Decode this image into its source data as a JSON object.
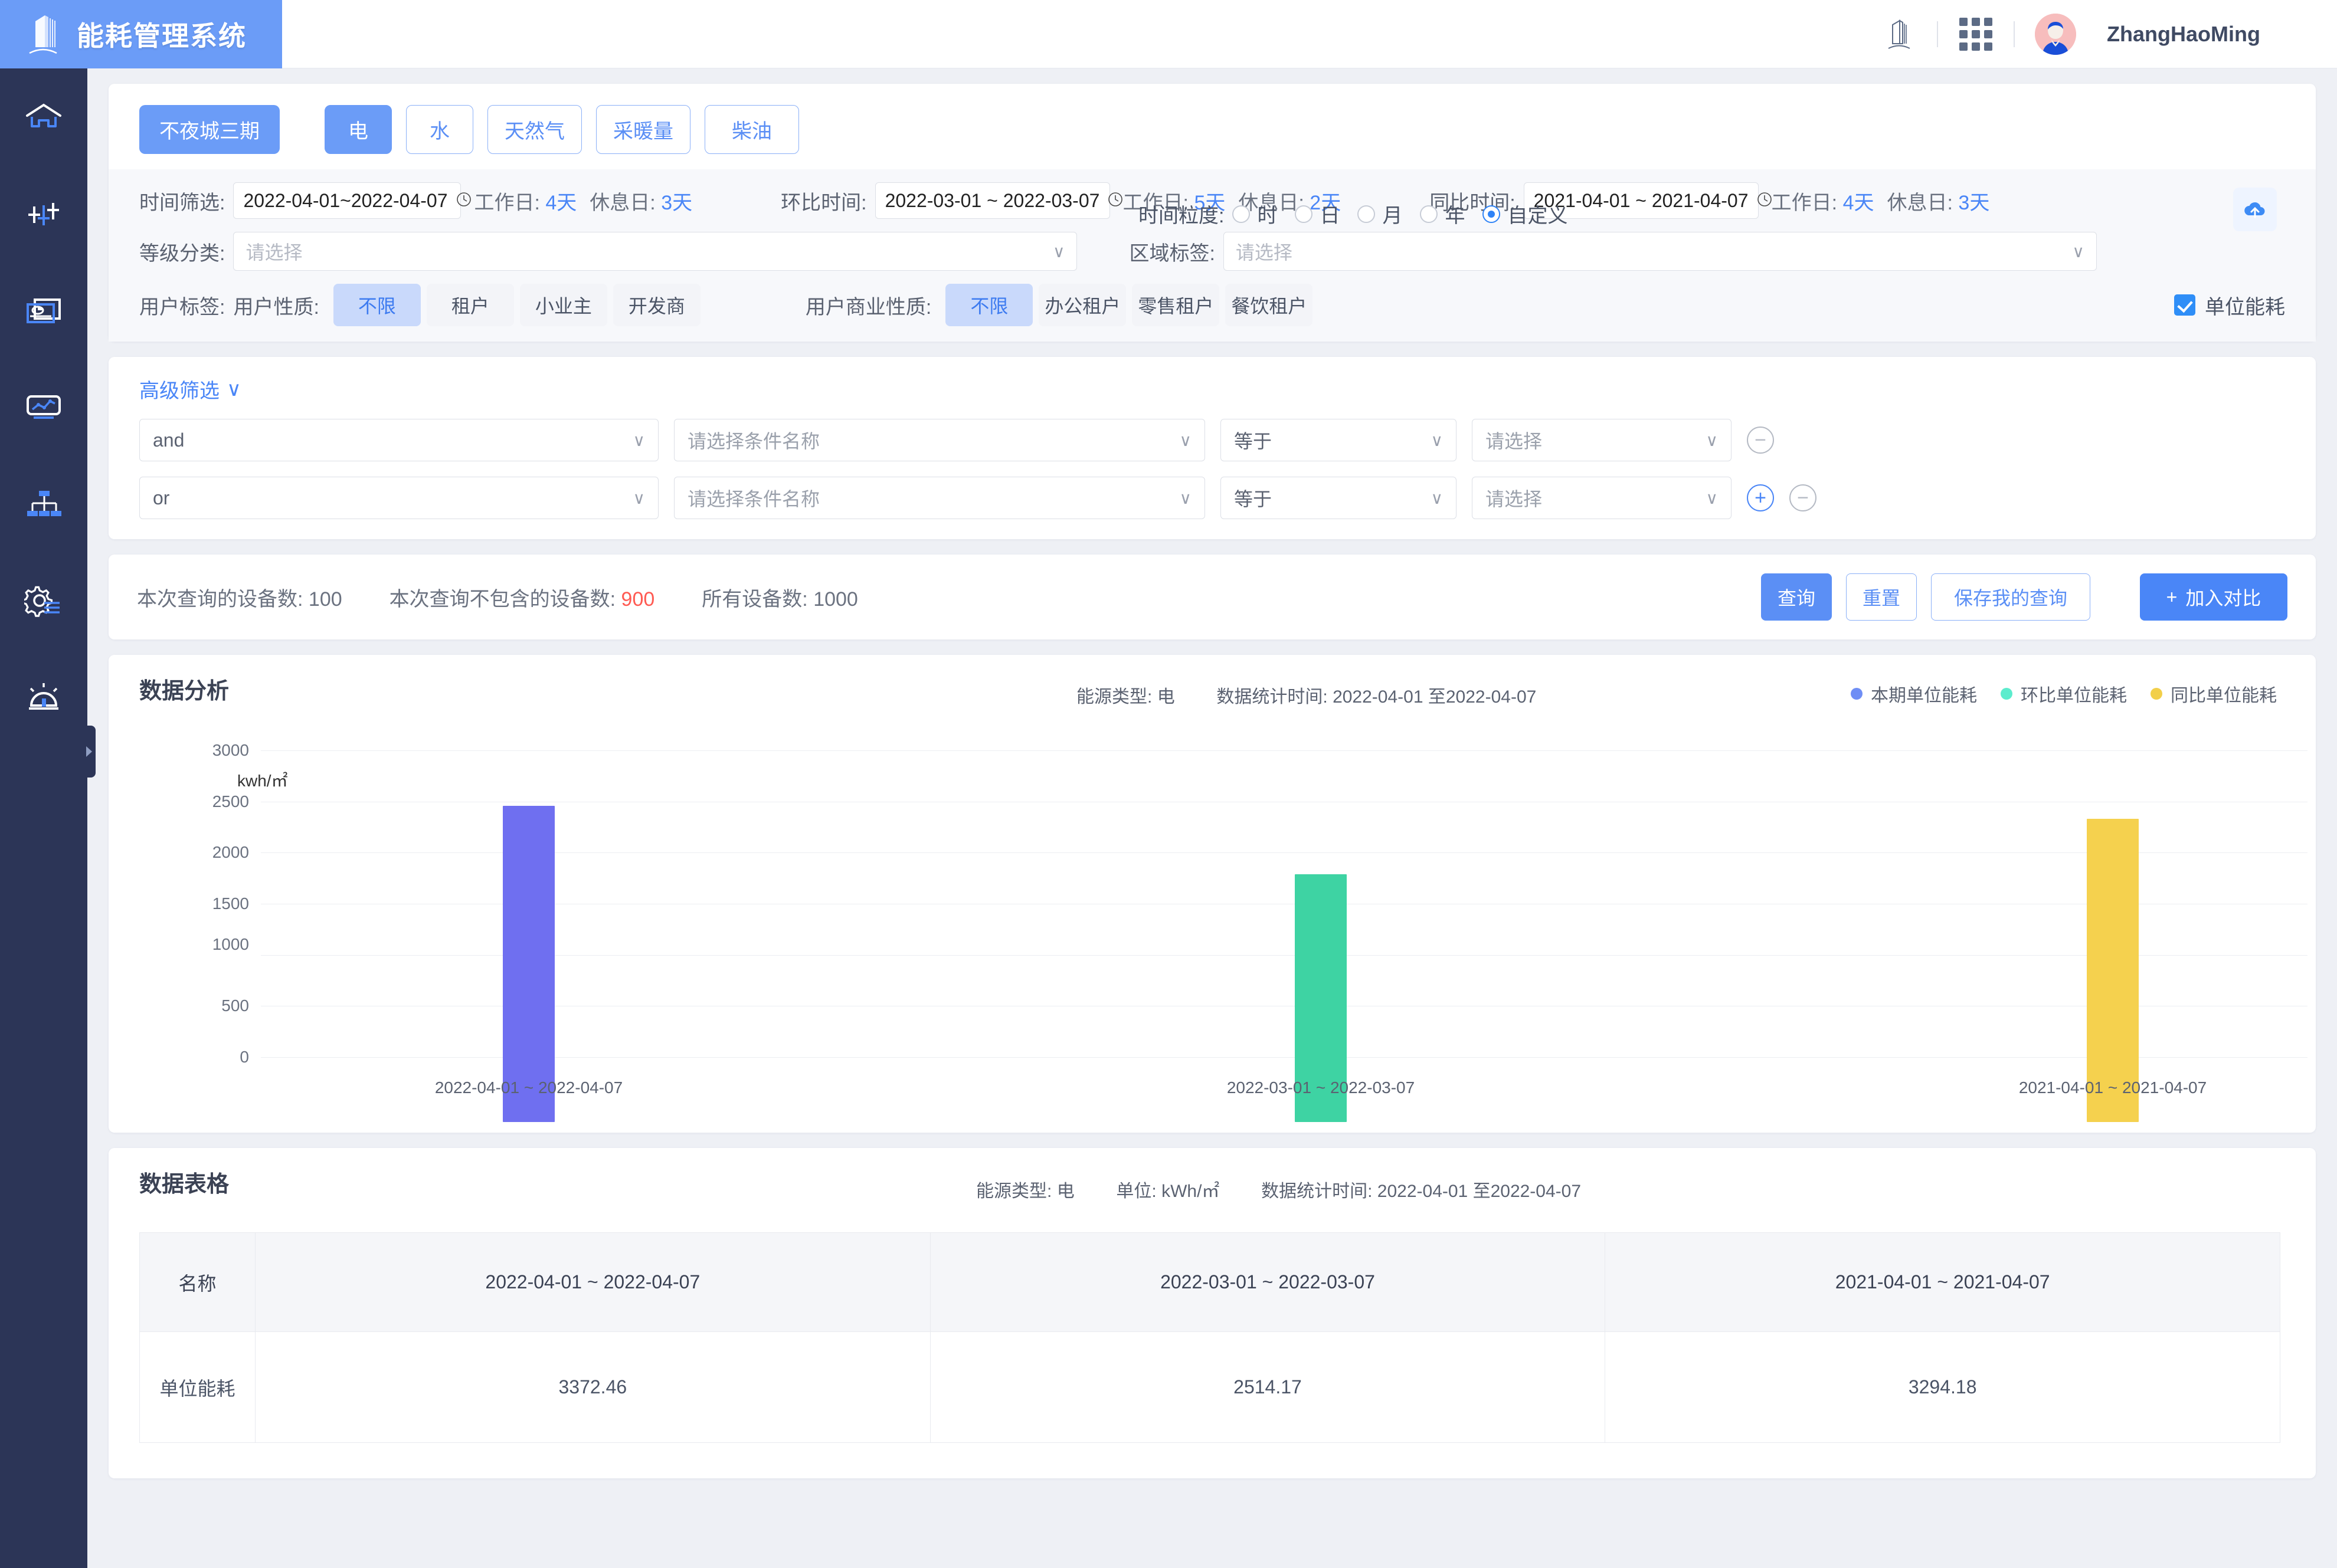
{
  "header": {
    "brand_title": "能耗管理系统",
    "building_icon": "building-icon",
    "apps_icon": "apps-grid-icon",
    "username": "ZhangHaoMing"
  },
  "sidebar": {
    "items": [
      {
        "name": "home",
        "icon": "home-icon"
      },
      {
        "name": "monitor",
        "icon": "sliders-icon"
      },
      {
        "name": "report",
        "icon": "report-card-icon"
      },
      {
        "name": "analysis",
        "icon": "line-chart-icon"
      },
      {
        "name": "topology",
        "icon": "org-tree-icon"
      },
      {
        "name": "settings",
        "icon": "gear-settings-icon"
      },
      {
        "name": "alarm",
        "icon": "alarm-dome-icon"
      }
    ],
    "collapse_handle": "sidebar-collapse-handle"
  },
  "filters": {
    "project_button": "不夜城三期",
    "energy_tabs": [
      {
        "label": "电",
        "active": true
      },
      {
        "label": "水",
        "active": false
      },
      {
        "label": "天然气",
        "active": false
      },
      {
        "label": "采暖量",
        "active": false
      },
      {
        "label": "柴油",
        "active": false
      }
    ],
    "granularity": {
      "label": "时间粒度:",
      "options": [
        {
          "label": "时",
          "selected": false
        },
        {
          "label": "日",
          "selected": false
        },
        {
          "label": "月",
          "selected": false
        },
        {
          "label": "年",
          "selected": false
        },
        {
          "label": "自定义",
          "selected": true
        }
      ]
    },
    "upload_icon": "cloud-upload-icon",
    "time_filter": {
      "label": "时间筛选:",
      "value": "2022-04-01~2022-04-07",
      "workday_label": "工作日:",
      "workday_value": "4天",
      "restday_label": "休息日:",
      "restday_value": "3天"
    },
    "mom_time": {
      "label": "环比时间:",
      "value": "2022-03-01 ~ 2022-03-07",
      "workday_label": "工作日:",
      "workday_value": "5天",
      "restday_label": "休息日:",
      "restday_value": "2天"
    },
    "yoy_time": {
      "label": "同比时间:",
      "value": "2021-04-01 ~ 2021-04-07",
      "workday_label": "工作日:",
      "workday_value": "4天",
      "restday_label": "休息日:",
      "restday_value": "3天"
    },
    "level_class": {
      "label": "等级分类:",
      "placeholder": "请选择"
    },
    "area_tag": {
      "label": "区域标签:",
      "placeholder": "请选择"
    },
    "user_tag_label": "用户标签:",
    "user_nature": {
      "label": "用户性质:",
      "options": [
        {
          "label": "不限",
          "selected": true
        },
        {
          "label": "租户",
          "selected": false
        },
        {
          "label": "小业主",
          "selected": false
        },
        {
          "label": "开发商",
          "selected": false
        }
      ]
    },
    "user_business_nature": {
      "label": "用户商业性质:",
      "options": [
        {
          "label": "不限",
          "selected": true
        },
        {
          "label": "办公租户",
          "selected": false
        },
        {
          "label": "零售租户",
          "selected": false
        },
        {
          "label": "餐饮租户",
          "selected": false
        }
      ]
    },
    "unit_energy_checkbox": {
      "label": "单位能耗",
      "checked": true
    }
  },
  "advanced": {
    "title": "高级筛选",
    "rows": [
      {
        "logic": "and",
        "field": "请选择条件名称",
        "operator": "等于",
        "value": "请选择",
        "has_add": false
      },
      {
        "logic": "or",
        "field": "请选择条件名称",
        "operator": "等于",
        "value": "请选择",
        "has_add": true
      }
    ]
  },
  "query": {
    "queried_devices_label": "本次查询的设备数:",
    "queried_devices_value": "100",
    "excluded_devices_label": "本次查询不包含的设备数:",
    "excluded_devices_value": "900",
    "all_devices_label": "所有设备数:",
    "all_devices_value": "1000",
    "btn_query": "查询",
    "btn_reset": "重置",
    "btn_save": "保存我的查询",
    "btn_compare": "加入对比"
  },
  "chart_section": {
    "title": "数据分析",
    "energy_type_label": "能源类型:",
    "energy_type_value": "电",
    "stat_time_label": "数据统计时间:",
    "stat_time_value": "2022-04-01 至2022-04-07"
  },
  "table_section": {
    "title": "数据表格",
    "energy_type_label": "能源类型:",
    "energy_type_value": "电",
    "unit_label": "单位:",
    "unit_value": "kWh/㎡",
    "stat_time_label": "数据统计时间:",
    "stat_time_value": "2022-04-01 至2022-04-07",
    "columns": [
      "名称",
      "2022-04-01 ~ 2022-04-07",
      "2022-03-01 ~ 2022-03-07",
      "2021-04-01 ~ 2021-04-07"
    ],
    "rows": [
      {
        "name": "单位能耗",
        "values": [
          "3372.46",
          "2514.17",
          "3294.18"
        ]
      }
    ]
  },
  "chart_data": {
    "type": "bar",
    "title": "数据分析",
    "ylabel": "kwh/㎡",
    "xlabel": "",
    "ylim": [
      0,
      3000
    ],
    "yticks": [
      0,
      500,
      1000,
      1500,
      2000,
      2500,
      3000
    ],
    "grid": true,
    "legend_position": "top-right",
    "categories": [
      "2022-04-01 ~ 2022-04-07",
      "2022-03-01 ~ 2022-03-07",
      "2021-04-01 ~ 2021-04-07"
    ],
    "series": [
      {
        "name": "本期单位能耗",
        "color": "#7b7bf0",
        "values": [
          3372.46,
          null,
          null
        ]
      },
      {
        "name": "环比单位能耗",
        "color": "#3fd1a0",
        "values": [
          null,
          2514.17,
          null
        ]
      },
      {
        "name": "同比单位能耗",
        "color": "#f5d14e",
        "values": [
          null,
          null,
          3294.18
        ]
      }
    ],
    "legend": [
      "本期单位能耗",
      "环比单位能耗",
      "同比单位能耗"
    ]
  },
  "colors": {
    "brand_blue": "#6b9cf7",
    "sidebar": "#2c3557",
    "accent": "#4a86f7",
    "danger": "#ff5a52",
    "series_current": "#7b7bf0",
    "series_mom": "#3fd1a0",
    "series_yoy": "#f5d14e"
  }
}
